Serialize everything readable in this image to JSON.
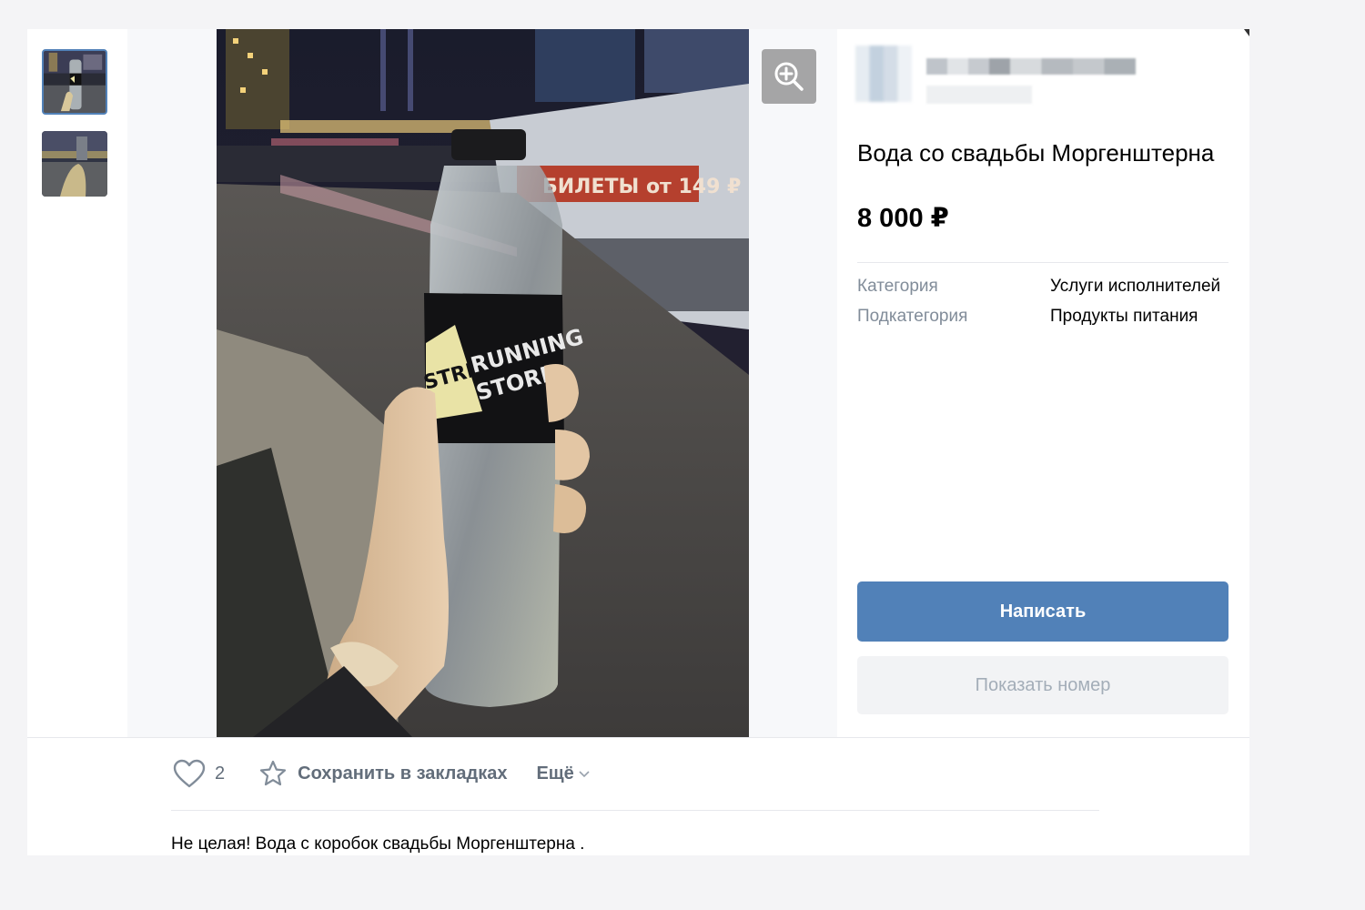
{
  "product": {
    "title": "Вода со свадьбы Моргенштерна",
    "price": "8 000 ₽",
    "description": "Не целая! Вода с коробок свадьбы Моргенштерна ."
  },
  "properties": [
    {
      "key": "Категория",
      "value": "Услуги исполнителей"
    },
    {
      "key": "Подкатегория",
      "value": "Продукты питания"
    }
  ],
  "buttons": {
    "write": "Написать",
    "show_number": "Показать номер"
  },
  "actions": {
    "likes_count": "2",
    "bookmark": "Сохранить в закладках",
    "more": "Ещё"
  },
  "photo": {
    "sign_text": "БИЛЕТЫ от 149 ₽",
    "label_brand": "STRIDE",
    "label_line1": "RUNNING",
    "label_line2": "STORE"
  },
  "icons": {
    "zoom": "zoom-in-icon",
    "like": "heart-icon",
    "bookmark": "star-icon",
    "more": "chevron-down-icon"
  },
  "colors": {
    "accent": "#5181b8",
    "secondary_bg": "#f2f3f5",
    "muted_text": "#818c99"
  }
}
